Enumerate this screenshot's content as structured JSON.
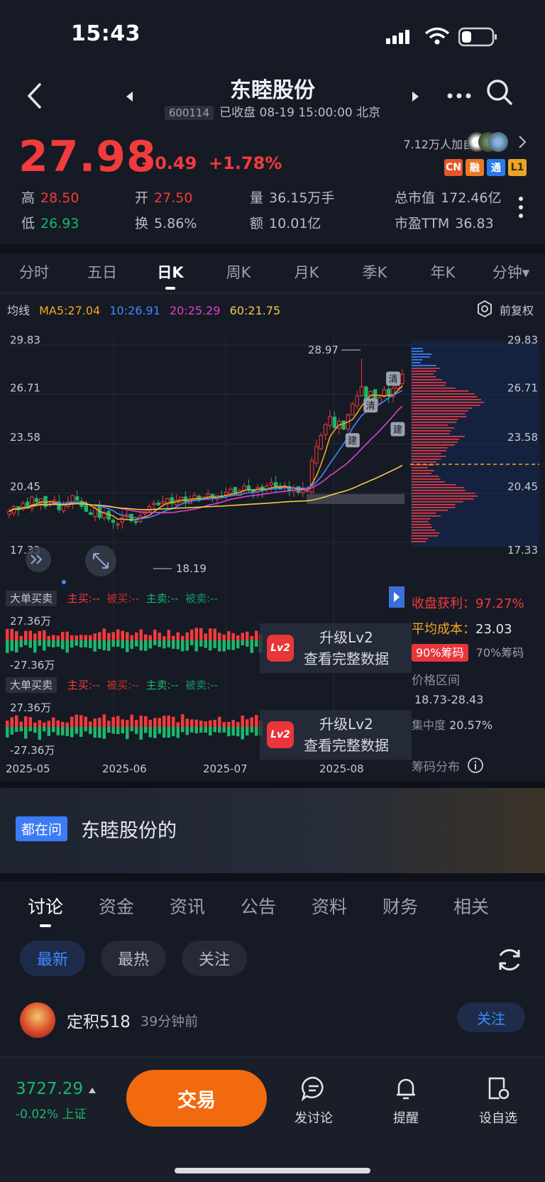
{
  "status": {
    "time": "15:43"
  },
  "header": {
    "title": "东睦股份",
    "code": "600114",
    "status_line": "已收盘 08-19 15:00:00 北京"
  },
  "quote": {
    "price": "27.98",
    "change": "+0.49",
    "change_pct": "+1.78%",
    "followers": "7.12万人加自选",
    "tags": [
      "CN",
      "融",
      "通",
      "L1"
    ],
    "high_label": "高",
    "high": "28.50",
    "low_label": "低",
    "low": "26.93",
    "open_label": "开",
    "open": "27.50",
    "turnover_label": "换",
    "turnover": "5.86%",
    "volume_label": "量",
    "volume": "36.15万手",
    "amount_label": "额",
    "amount": "10.01亿",
    "mktcap_label": "总市值",
    "mktcap": "172.46亿",
    "pe_label": "市盈TTM",
    "pe": "36.83"
  },
  "ktabs": [
    "分时",
    "五日",
    "日K",
    "周K",
    "月K",
    "季K",
    "年K",
    "分钟▾"
  ],
  "ktabs_active": "日K",
  "ma_legend": {
    "label": "均线",
    "ma5": "MA5:27.04",
    "ma10": "10:26.91",
    "ma20": "20:25.29",
    "ma60": "60:21.75",
    "adjust": "前复权"
  },
  "colors": {
    "up": "#f23b3b",
    "down": "#19b86b",
    "ma5": "#f5a623",
    "ma10": "#3d8bff",
    "ma20": "#e040c8",
    "ma60": "#f2c94c",
    "accent": "#f26a0f"
  },
  "chart_data": {
    "type": "candlestick",
    "price_axis": [
      "29.83",
      "26.71",
      "23.58",
      "20.45",
      "17.33"
    ],
    "ylim": [
      17.33,
      29.83
    ],
    "x_ticks": [
      "2025-05",
      "2025-06",
      "2025-07",
      "2025-08"
    ],
    "annotations": {
      "high": "28.97",
      "low": "18.19"
    },
    "marks": [
      "清",
      "清",
      "建",
      "建"
    ],
    "close_series": [
      19.3,
      19.6,
      19.4,
      19.8,
      19.5,
      20.2,
      19.9,
      20.1,
      19.6,
      19.8,
      20.0,
      19.4,
      19.7,
      19.9,
      20.3,
      20.0,
      19.6,
      19.3,
      19.1,
      19.5,
      18.9,
      19.2,
      18.8,
      18.6,
      18.5,
      18.9,
      19.1,
      18.7,
      18.6,
      19.0,
      19.3,
      19.6,
      19.8,
      19.7,
      19.9,
      20.1,
      19.8,
      20.0,
      20.2,
      19.9,
      20.1,
      20.3,
      20.0,
      20.2,
      20.4,
      20.1,
      20.3,
      20.2,
      20.5,
      20.7,
      20.4,
      20.6,
      20.9,
      20.7,
      20.5,
      20.8,
      20.6,
      20.9,
      21.1,
      20.8,
      20.7,
      20.9,
      20.6,
      20.8,
      20.5,
      20.7,
      20.6,
      22.5,
      23.4,
      24.1,
      24.8,
      25.3,
      24.6,
      25.0,
      24.5,
      25.4,
      26.1,
      26.6,
      27.2,
      26.4,
      26.9,
      26.2,
      26.5,
      27.0,
      26.6,
      27.1,
      27.49,
      27.98
    ]
  },
  "panels": [
    {
      "chip": "大单买卖",
      "zhumai": "主买:--",
      "beimai": "被买:--",
      "zhumai2": "主卖:--",
      "beimai2": "被卖:--",
      "top": "27.36万",
      "bottom": "-27.36万",
      "upgrade": "升级Lv2",
      "view": "查看完整数据",
      "badge": "Lv2"
    },
    {
      "chip": "大单买卖",
      "zhumai": "主买:--",
      "beimai": "被买:--",
      "zhumai2": "主卖:--",
      "beimai2": "被卖:--",
      "top": "27.36万",
      "bottom": "-27.36万",
      "upgrade": "升级Lv2",
      "view": "查看完整数据",
      "badge": "Lv2"
    }
  ],
  "chips": {
    "profit_label": "收盘获利：",
    "profit": "97.27%",
    "cost_label": "平均成本：",
    "cost": "23.03",
    "tab90": "90%筹码",
    "tab70": "70%筹码",
    "range_label": "价格区间",
    "range": "18.73-28.43",
    "concentration_label": "集中度",
    "concentration": "20.57%",
    "dist_label": "筹码分布"
  },
  "ask": {
    "chip": "都在问",
    "text": "东睦股份的"
  },
  "bottom_tabs": [
    "讨论",
    "资金",
    "资讯",
    "公告",
    "资料",
    "财务",
    "相关"
  ],
  "filters": [
    "最新",
    "最热",
    "关注"
  ],
  "post": {
    "user": "定积518",
    "time": "39分钟前",
    "follow": "关注"
  },
  "bottombar": {
    "index_value": "3727.29",
    "index_change": "-0.02%",
    "index_name": "上证",
    "trade": "交易",
    "discuss": "发讨论",
    "remind": "提醒",
    "watch": "设自选"
  }
}
